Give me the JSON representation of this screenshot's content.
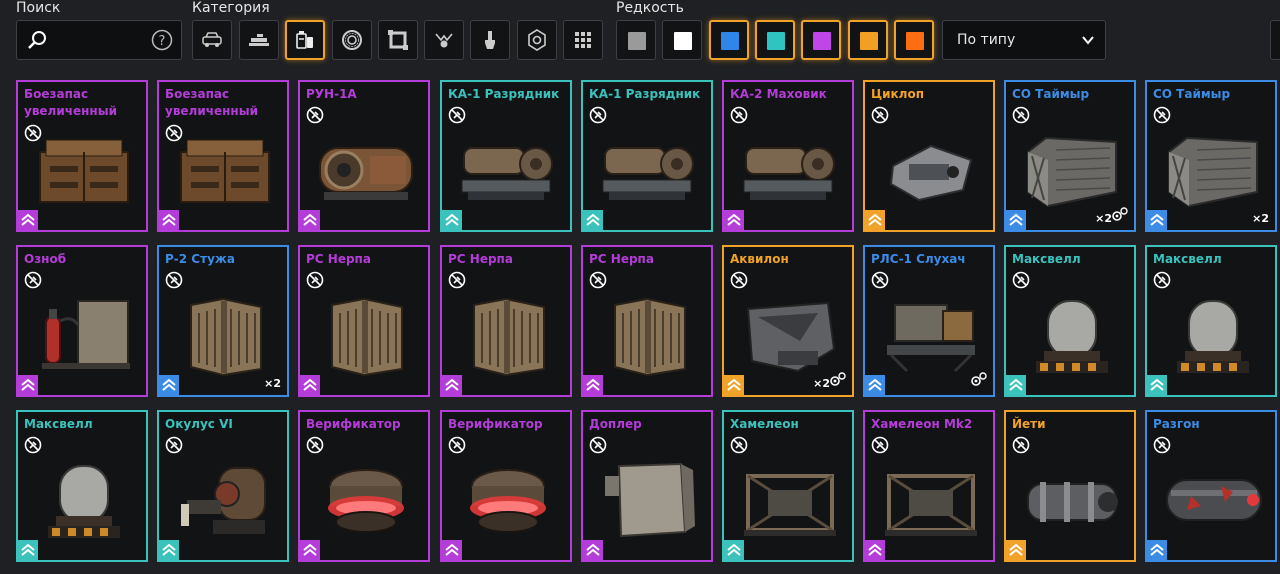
{
  "labels": {
    "search": "Поиск",
    "category": "Категория",
    "rarity": "Редкость"
  },
  "search": {
    "value": "",
    "placeholder": ""
  },
  "sort": {
    "selected": "По типу"
  },
  "rarity_colors": {
    "epic": "#b43cd8",
    "rare": "#3c8ce6",
    "special": "#3cc2bc",
    "legendary": "#f0a229",
    "relic": "#ff6a1a",
    "common": "#8a8a8a"
  },
  "categories": [
    {
      "icon": "car-icon",
      "active": false
    },
    {
      "icon": "weapon-icon",
      "active": false
    },
    {
      "icon": "module-icon",
      "active": true
    },
    {
      "icon": "wheel-icon",
      "active": false
    },
    {
      "icon": "frame-icon",
      "active": false
    },
    {
      "icon": "decor-icon",
      "active": false
    },
    {
      "icon": "paint-icon",
      "active": false
    },
    {
      "icon": "sticker-icon",
      "active": false
    },
    {
      "icon": "grid-icon",
      "active": false
    }
  ],
  "rarity_filters": [
    {
      "color": "#9a9a9a",
      "active": false
    },
    {
      "color": "#ffffff",
      "active": false
    },
    {
      "color": "#2f86e8",
      "active": true
    },
    {
      "color": "#2fc4c0",
      "active": true
    },
    {
      "color": "#c046e8",
      "active": true
    },
    {
      "color": "#f2a024",
      "active": true
    },
    {
      "color": "#ff6d12",
      "active": true
    }
  ],
  "items": [
    {
      "name": "Боезапас увеличенный",
      "rarity": "epic",
      "image": "ammo-crate"
    },
    {
      "name": "Боезапас увеличенный",
      "rarity": "epic",
      "image": "ammo-crate"
    },
    {
      "name": "РУН-1А",
      "rarity": "epic",
      "image": "generator"
    },
    {
      "name": "КА-1 Разрядник",
      "rarity": "special",
      "image": "engine"
    },
    {
      "name": "КА-1 Разрядник",
      "rarity": "special",
      "image": "engine"
    },
    {
      "name": "КА-2 Маховик",
      "rarity": "epic",
      "image": "engine"
    },
    {
      "name": "Циклоп",
      "rarity": "legendary",
      "image": "turret"
    },
    {
      "name": "СО Таймыр",
      "rarity": "rare",
      "image": "cooler-box",
      "qty": "×2",
      "parts": true
    },
    {
      "name": "СО Таймыр",
      "rarity": "rare",
      "image": "cooler-box",
      "qty": "×2",
      "parts": false
    },
    {
      "name": "Озноб",
      "rarity": "epic",
      "image": "extinguisher"
    },
    {
      "name": "Р-2 Стужа",
      "rarity": "rare",
      "image": "radiator",
      "qty": "×2",
      "parts": false
    },
    {
      "name": "РС Нерпа",
      "rarity": "epic",
      "image": "radiator"
    },
    {
      "name": "РС Нерпа",
      "rarity": "epic",
      "image": "radiator"
    },
    {
      "name": "РС Нерпа",
      "rarity": "epic",
      "image": "radiator"
    },
    {
      "name": "Аквилон",
      "rarity": "legendary",
      "image": "wedge",
      "qty": "×2",
      "parts": true
    },
    {
      "name": "РЛС-1 Слухач",
      "rarity": "rare",
      "image": "radar",
      "parts": true
    },
    {
      "name": "Максвелл",
      "rarity": "special",
      "image": "capsule"
    },
    {
      "name": "Максвелл",
      "rarity": "special",
      "image": "capsule"
    },
    {
      "name": "Максвелл",
      "rarity": "special",
      "image": "capsule"
    },
    {
      "name": "Окулус VI",
      "rarity": "special",
      "image": "camera"
    },
    {
      "name": "Верификатор",
      "rarity": "epic",
      "image": "verifier"
    },
    {
      "name": "Верификатор",
      "rarity": "epic",
      "image": "verifier"
    },
    {
      "name": "Доплер",
      "rarity": "epic",
      "image": "box"
    },
    {
      "name": "Хамелеон",
      "rarity": "special",
      "image": "cage"
    },
    {
      "name": "Хамелеон Mk2",
      "rarity": "epic",
      "image": "cage"
    },
    {
      "name": "Йети",
      "rarity": "legendary",
      "image": "cylinder"
    },
    {
      "name": "Разгон",
      "rarity": "rare",
      "image": "tank"
    }
  ]
}
